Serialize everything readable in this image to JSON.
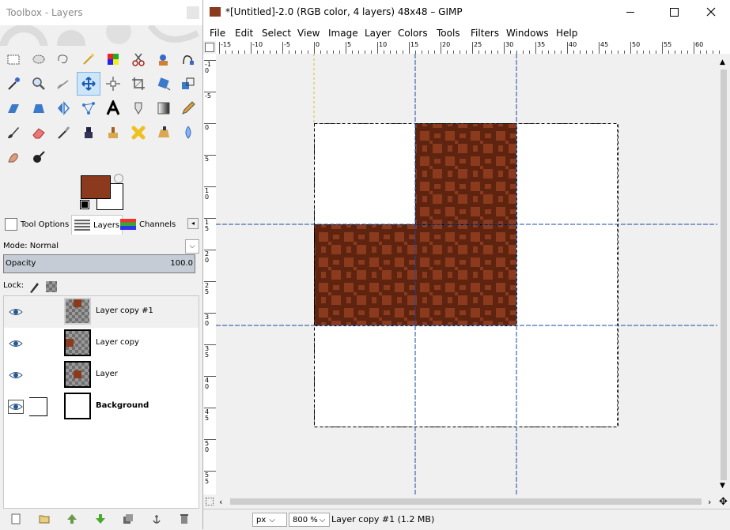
{
  "toolbox": {
    "title": "Toolbox - Layers",
    "foreground_color": "#8b3a1e",
    "background_color": "#ffffff",
    "tools": [
      "rect-select",
      "ellipse-select",
      "free-select",
      "fuzzy-select",
      "color-select",
      "scissors-select",
      "foreground-select",
      "paths",
      "color-picker",
      "zoom",
      "measure",
      "move",
      "align",
      "crop",
      "rotate",
      "scale",
      "shear",
      "perspective",
      "flip",
      "cage",
      "text",
      "heal",
      "blend",
      "pencil",
      "paintbrush",
      "eraser",
      "airbrush",
      "ink",
      "clone",
      "heal-bandaid",
      "perspective-clone",
      "blur",
      "smudge",
      "dodge-burn"
    ]
  },
  "tabs": [
    {
      "label": "Tool Options",
      "icon": "tool-options-icon"
    },
    {
      "label": "Layers",
      "icon": "layers-icon"
    },
    {
      "label": "Channels",
      "icon": "channels-icon"
    }
  ],
  "layers_panel": {
    "mode_label": "Mode: Normal",
    "opacity_label": "Opacity",
    "opacity_value": "100.0",
    "opacity_fraction": 1.0,
    "lock_label": "Lock:",
    "layers": [
      {
        "name": "Layer copy #1",
        "selected": true,
        "bold": false,
        "thumb": "checker-top"
      },
      {
        "name": "Layer copy",
        "selected": false,
        "bold": false,
        "thumb": "checker-left"
      },
      {
        "name": "Layer",
        "selected": false,
        "bold": false,
        "thumb": "checker-center"
      },
      {
        "name": "Background",
        "selected": false,
        "bold": true,
        "thumb": "white"
      }
    ],
    "buttons": [
      "new-layer-icon",
      "new-group-icon",
      "raise-layer-icon",
      "lower-layer-icon",
      "duplicate-layer-icon",
      "anchor-layer-icon",
      "delete-layer-icon"
    ]
  },
  "image_window": {
    "title": "*[Untitled]-2.0 (RGB color, 4 layers) 48x48 – GIMP",
    "menus": [
      "File",
      "Edit",
      "Select",
      "View",
      "Image",
      "Layer",
      "Colors",
      "Tools",
      "Filters",
      "Windows",
      "Help"
    ],
    "hruler_labels": [
      "-15",
      "-10",
      "-5",
      "0",
      "5",
      "10",
      "15",
      "20",
      "25",
      "30",
      "35",
      "40",
      "45",
      "50",
      "55",
      "60"
    ],
    "vruler_labels": [
      "-10",
      "-5",
      "0",
      "5",
      "10",
      "15",
      "20",
      "25",
      "30",
      "35",
      "40",
      "45",
      "50",
      "55"
    ],
    "brick_color": "#8b3a1e",
    "brick_dark": "#5e2410"
  },
  "statusbar": {
    "unit": "px",
    "zoom": "800 %",
    "info": "Layer copy #1 (1.2 MB)"
  }
}
